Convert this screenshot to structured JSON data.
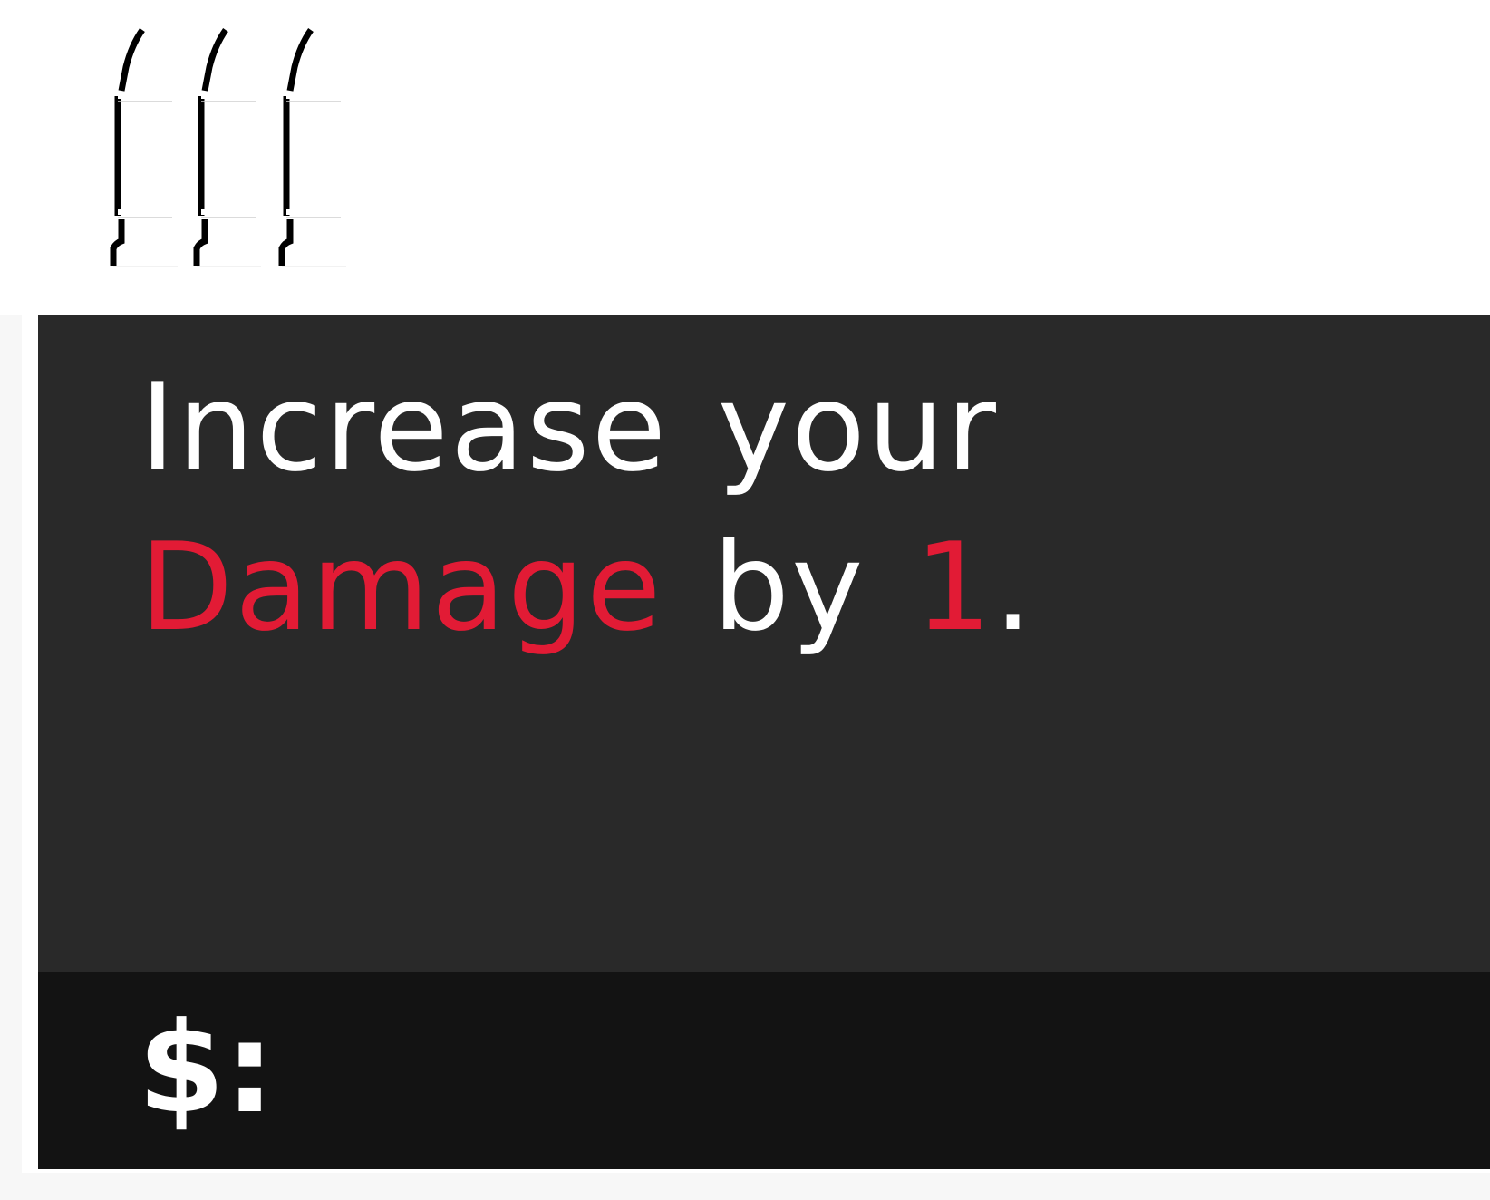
{
  "ammo": {
    "count": 3,
    "icon": "bullet-icon",
    "outline_color": "#000000",
    "fill_color": "#ffffff"
  },
  "card": {
    "text_parts": [
      "Increase your ",
      "Damage",
      " by ",
      "1",
      "."
    ],
    "highlight_color": "#e21b35",
    "text_color": "#ffffff",
    "background_color": "#292929"
  },
  "cost": {
    "label": "$:",
    "value": "",
    "bar_color": "#131313"
  }
}
